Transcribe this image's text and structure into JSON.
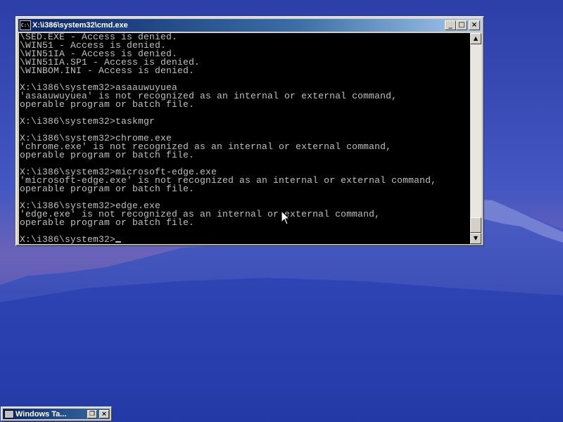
{
  "window": {
    "title": "X:\\i386\\system32\\cmd.exe",
    "icon": "cmd-console-icon",
    "icon_text": "C:\\",
    "minimize_label": "_",
    "maximize_label": "□",
    "close_label": "×"
  },
  "console": {
    "lines": [
      "\\SED.EXE - Access is denied.",
      "\\WIN51 - Access is denied.",
      "\\WIN51IA - Access is denied.",
      "\\WIN51IA.SP1 - Access is denied.",
      "\\WINBOM.INI - Access is denied.",
      "",
      "X:\\i386\\system32>asaauwuyuea",
      "'asaauwuyuea' is not recognized as an internal or external command,",
      "operable program or batch file.",
      "",
      "X:\\i386\\system32>taskmgr",
      "",
      "X:\\i386\\system32>chrome.exe",
      "'chrome.exe' is not recognized as an internal or external command,",
      "operable program or batch file.",
      "",
      "X:\\i386\\system32>microsoft-edge.exe",
      "'microsoft-edge.exe' is not recognized as an internal or external command,",
      "operable program or batch file.",
      "",
      "X:\\i386\\system32>edge.exe",
      "'edge.exe' is not recognized as an internal or external command,",
      "operable program or batch file.",
      ""
    ],
    "prompt": "X:\\i386\\system32>",
    "text_color": "#c0c0c0",
    "background_color": "#000000"
  },
  "scrollbar": {
    "up_arrow": "▲",
    "down_arrow": "▼",
    "position": 0.92
  },
  "taskbar": {
    "minimized_window_label": "Windows Ta...",
    "restore_label": "❐",
    "close_label": "×"
  },
  "colors": {
    "title_active": "#0a246a",
    "title_gradient_end": "#a6caf0",
    "face": "#d4d0c8"
  }
}
